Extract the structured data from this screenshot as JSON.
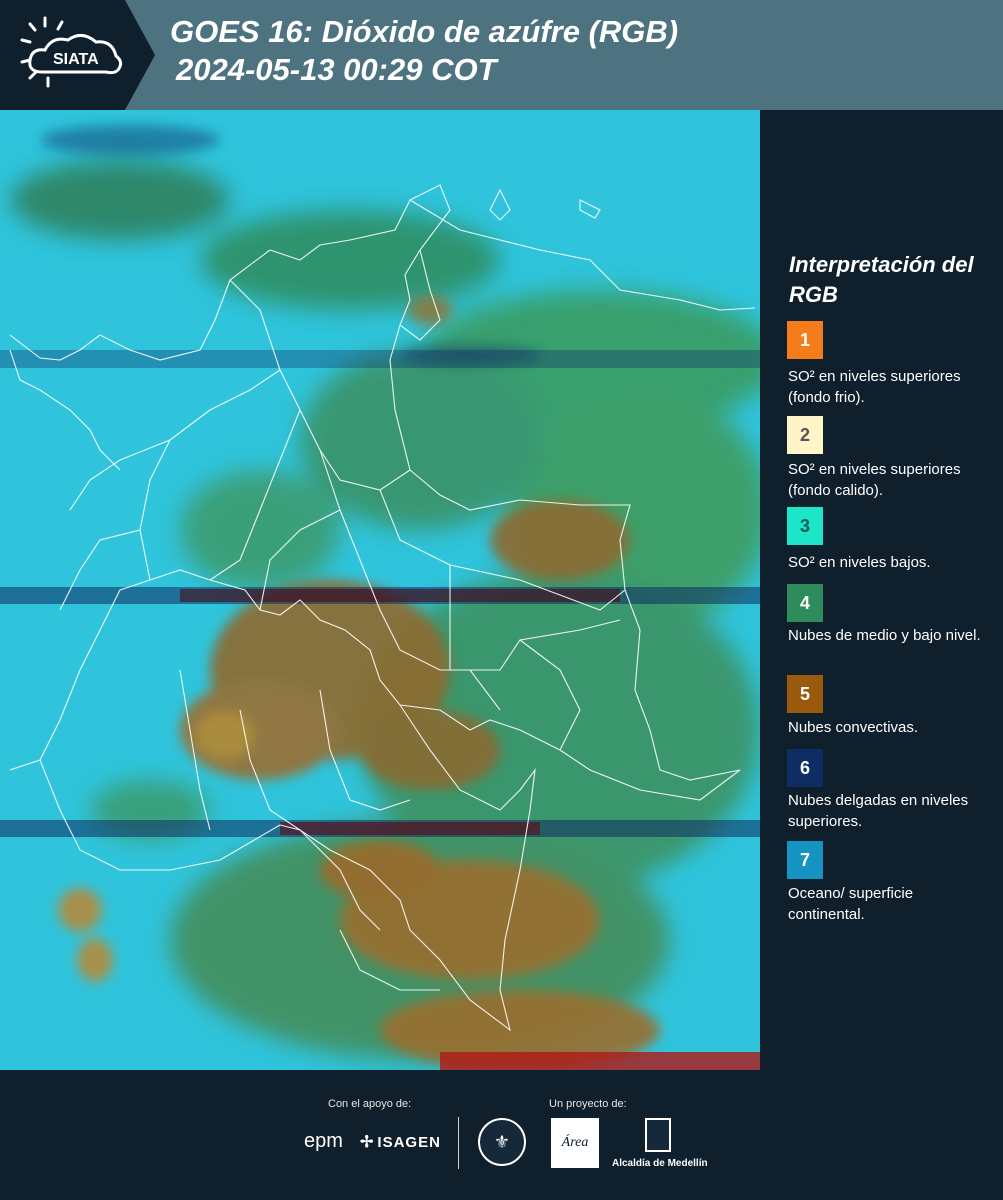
{
  "header": {
    "logo_text": "SIATA",
    "title_line1": "GOES 16: Dióxido de azúfre (RGB)",
    "title_line2": "2024-05-13 00:29 COT",
    "background_color": "#4d7280",
    "logo_block_color": "#0f1f2b"
  },
  "legend": {
    "title": "Interpretación del RGB",
    "items": [
      {
        "number": "1",
        "color": "#f57c1a",
        "number_color": "#ffffff",
        "label": "SO² en niveles superiores (fondo frio)."
      },
      {
        "number": "2",
        "color": "#fff5c8",
        "number_color": "#555555",
        "label": "SO² en niveles superiores (fondo calido)."
      },
      {
        "number": "3",
        "color": "#1de5c7",
        "number_color": "#0f5d56",
        "label": "SO² en niveles bajos."
      },
      {
        "number": "4",
        "color": "#2e8b5b",
        "number_color": "#ffffff",
        "label": "Nubes de medio y bajo nivel."
      },
      {
        "number": "5",
        "color": "#9a5a0d",
        "number_color": "#ffffff",
        "label": "Nubes convectivas."
      },
      {
        "number": "6",
        "color": "#0e2d63",
        "number_color": "#ffffff",
        "label": "Nubes delgadas en niveles superiores."
      },
      {
        "number": "7",
        "color": "#1593c3",
        "number_color": "#ffffff",
        "label": "Oceano/ superficie continental."
      }
    ]
  },
  "footer": {
    "support_caption": "Con el apoyo de:",
    "project_caption": "Un proyecto de:",
    "epm_logo_text": "epm",
    "isagen_logo_text": "ISAGEN",
    "area_logo_text": "Área",
    "alcaldia_label": "Alcaldía de Medellín"
  },
  "map": {
    "ocean_color": "#2fc4dc",
    "cloud_colors": [
      "#2e8b5b",
      "#9a6a2a",
      "#0e2d63",
      "#b01818"
    ],
    "boundary_color": "#ffffff"
  }
}
